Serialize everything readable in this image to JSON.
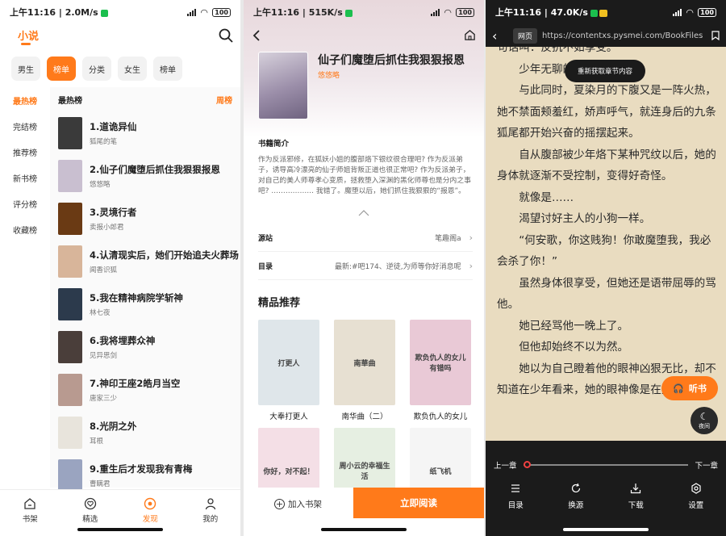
{
  "p1": {
    "status": {
      "time": "上午11:16 | 2.0M/s",
      "battery": "100"
    },
    "title": "小说",
    "categories": [
      {
        "label": "男生"
      },
      {
        "label": "榜单"
      },
      {
        "label": "分类"
      },
      {
        "label": "女生"
      },
      {
        "label": "榜单"
      }
    ],
    "sidebar": [
      "最热榜",
      "完结榜",
      "推荐榜",
      "新书榜",
      "评分榜",
      "收藏榜"
    ],
    "list_title": "最热榜",
    "period": "周榜",
    "books": [
      {
        "title": "1.道诡异仙",
        "author": "狐尾的笔",
        "color": "#3a3a3a"
      },
      {
        "title": "2.仙子们魔堕后抓住我狠狠报恩",
        "author": "悠悠略",
        "color": "#c9bfd0"
      },
      {
        "title": "3.灵境行者",
        "author": "卖报小郎君",
        "color": "#6a3a14"
      },
      {
        "title": "4.认清现实后，她们开始追夫火葬场",
        "author": "闻香识狐",
        "color": "#d8b59a"
      },
      {
        "title": "5.我在精神病院学斩神",
        "author": "林七夜",
        "color": "#2c3a4c"
      },
      {
        "title": "6.我将埋葬众神",
        "author": "见异思剑",
        "color": "#4a3e3a"
      },
      {
        "title": "7.神印王座2皓月当空",
        "author": "唐家三少",
        "color": "#b89a90"
      },
      {
        "title": "8.光阴之外",
        "author": "耳根",
        "color": "#e8e4dc"
      },
      {
        "title": "9.重生后才发现我有青梅",
        "author": "曹瞒君",
        "color": "#9aa4c0"
      }
    ],
    "tabs": [
      {
        "label": "书架"
      },
      {
        "label": "精选"
      },
      {
        "label": "发现"
      },
      {
        "label": "我的"
      }
    ]
  },
  "p2": {
    "status": {
      "time": "上午11:16 | 515K/s",
      "battery": "100"
    },
    "book_title": "仙子们魔堕后抓住我狠狠报恩",
    "author": "悠悠略",
    "intro_label": "书籍简介",
    "intro": "作为反派邪修，在狐妖小姐的腹部烙下银纹很合理吧? 作为反派弟子，诱导高冷漂亮的仙子师姐背叛正道也很正常吧? 作为反派弟子，对自己的美人师尊孝心变质，拯救堕入深渊的黑化师尊也是分内之事吧? ……………… 我错了。魔堕以后，她们抓住我狠狠的“报恩”。",
    "source_label": "源站",
    "source_value": "笔趣阁a",
    "toc_label": "目录",
    "toc_value": "最新:#吧174、逆徒,为师等你好消息呢",
    "recs_title": "精品推荐",
    "recs": [
      {
        "name": "大奉打更人",
        "color": "#dfe6ea"
      },
      {
        "name": "南华曲（二）",
        "color": "#e7e0d2"
      },
      {
        "name": "欺负仇人的女儿",
        "color": "#e9c9d6"
      },
      {
        "name": "",
        "color": "#f4dfe6"
      },
      {
        "name": "",
        "color": "#e6efe2"
      },
      {
        "name": "",
        "color": "#f5f5f5"
      }
    ],
    "cover_texts": [
      "打更人",
      "南華曲",
      "欺负仇人的女儿有错吗",
      "你好，对不起！",
      "周小云的幸福生活",
      "纸飞机"
    ],
    "add_shelf": "加入书架",
    "read_now": "立即阅读"
  },
  "p3": {
    "status": {
      "time": "上午11:16 | 47.0K/s",
      "battery": "100"
    },
    "web_chip": "网页",
    "url": "https://contentxs.pysmei.com/BookFiles",
    "toast": "重新获取章节内容",
    "paragraphs": [
      "句话叫：反抗不如享受。”",
      "少年无聊的打了个哈欠。",
      "与此同时，夏染月的下腹又是一阵火热，她不禁面颊羞红，娇声呼气，就连身后的九条狐尾都开始兴奋的摇摆起来。",
      "自从腹部被少年烙下某种咒纹以后，她的身体就逐渐不受控制，变得好奇怪。",
      "就像是……",
      "渴望讨好主人的小狗一样。",
      "“何安歌，你这贱狗！你敢魔堕我，我必会杀了你！”",
      "虽然身体很享受，但她还是语带屈辱的骂他。",
      "她已经骂他一晚上了。",
      "但他却始终不以为然。",
      "她以为自己瞪着他的眼神凶狠无比，却不知道在少年看来，她的眼神像是在撒娇。"
    ],
    "listen": "听书",
    "night": "夜间",
    "prev": "上一章",
    "next": "下一章",
    "progress": 0,
    "tools": [
      {
        "label": "目录"
      },
      {
        "label": "换源"
      },
      {
        "label": "下载"
      },
      {
        "label": "设置"
      }
    ]
  },
  "colors": {
    "accent": "#ff7a1a",
    "reader_bg": "#e9dcc0",
    "dark": "#1b1b1b"
  }
}
